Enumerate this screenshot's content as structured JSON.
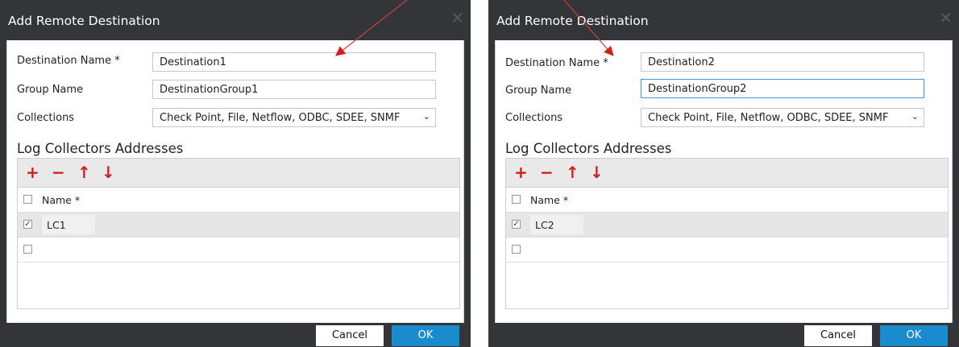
{
  "dialogs": [
    {
      "title": "Add Remote Destination",
      "close_glyph": "✕",
      "fields": {
        "destination_name_label": "Destination Name *",
        "destination_name_value": "Destination1",
        "group_name_label": "Group Name",
        "group_name_value": "DestinationGroup1",
        "collections_label": "Collections",
        "collections_value": "Check Point, File, Netflow, ODBC, SDEE, SNMF"
      },
      "section_title": "Log Collectors Addresses",
      "toolbar": {
        "add": "+",
        "remove": "−",
        "up": "↑",
        "down": "↓"
      },
      "grid": {
        "header": "Name *",
        "rows": [
          {
            "name": "LC1",
            "checked": true
          },
          {
            "name": "",
            "checked": false
          }
        ]
      },
      "buttons": {
        "cancel": "Cancel",
        "ok": "OK"
      }
    },
    {
      "title": "Add Remote Destination",
      "close_glyph": "✕",
      "fields": {
        "destination_name_label": "Destination Name *",
        "destination_name_value": "Destination2",
        "group_name_label": "Group Name",
        "group_name_value": "DestinationGroup2",
        "collections_label": "Collections",
        "collections_value": "Check Point, File, Netflow, ODBC, SDEE, SNMF"
      },
      "section_title": "Log Collectors Addresses",
      "toolbar": {
        "add": "+",
        "remove": "−",
        "up": "↑",
        "down": "↓"
      },
      "grid": {
        "header": "Name *",
        "rows": [
          {
            "name": "LC2",
            "checked": true
          },
          {
            "name": "",
            "checked": false
          }
        ]
      },
      "buttons": {
        "cancel": "Cancel",
        "ok": "OK"
      }
    }
  ],
  "glyphs": {
    "check": "✓",
    "chevron": "⌄"
  },
  "colors": {
    "titlebar": "#333538",
    "accent_red": "#d51b1b",
    "ok_button": "#1a8ccd",
    "focus_border": "#3d9bd9"
  }
}
